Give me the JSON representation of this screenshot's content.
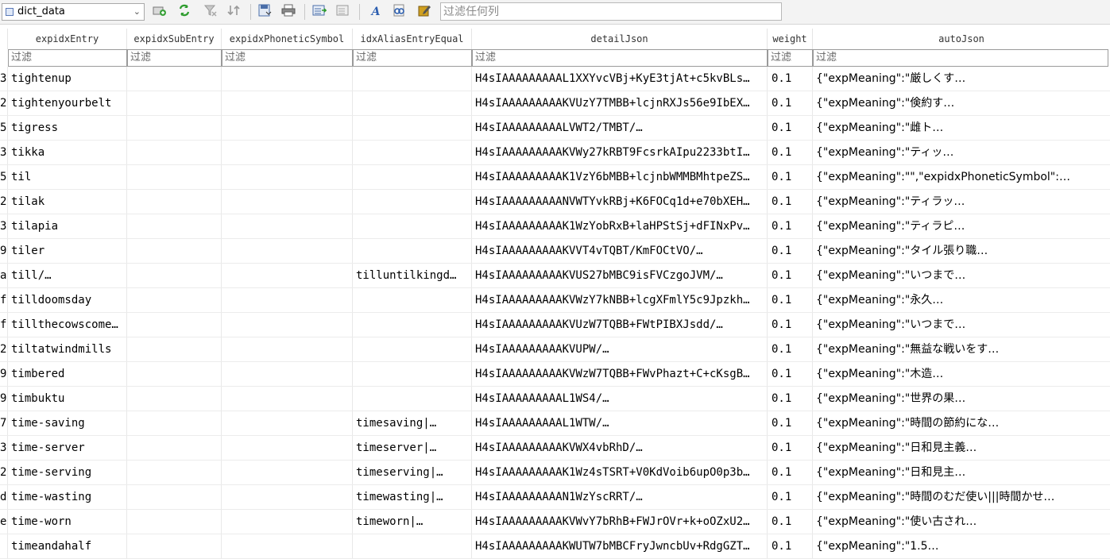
{
  "toolbar": {
    "table_name": "dict_data",
    "filter_placeholder": "过滤任何列",
    "icons": [
      "database-add-icon",
      "refresh-icon",
      "filter-clear-icon",
      "sort-clear-icon",
      "save-icon",
      "print-icon",
      "export-icon",
      "import-icon",
      "font-icon",
      "find-icon",
      "edit-icon"
    ]
  },
  "columns": [
    "expidxEntry",
    "expidxSubEntry",
    "expidxPhoneticSymbol",
    "idxAliasEntryEqual",
    "detailJson",
    "weight",
    "autoJson"
  ],
  "filter_placeholder": "过滤",
  "rows": [
    {
      "idx": "3",
      "entry": "tightenup",
      "sub": "",
      "phon": "",
      "alias": "",
      "detail": "H4sIAAAAAAAAAL1XXYvcVBj+KyE3tjAt+c5kvBLs…",
      "weight": "0.1",
      "auto": "{\"expMeaning\":\"厳しくす…"
    },
    {
      "idx": "2",
      "entry": "tightenyourbelt",
      "sub": "",
      "phon": "",
      "alias": "",
      "detail": "H4sIAAAAAAAAAKVUzY7TMBB+lcjnRXJs56e9IbEX…",
      "weight": "0.1",
      "auto": "{\"expMeaning\":\"倹約す…"
    },
    {
      "idx": "5",
      "entry": "tigress",
      "sub": "",
      "phon": "",
      "alias": "",
      "detail": "H4sIAAAAAAAAALVWT2/TMBT/…",
      "weight": "0.1",
      "auto": "{\"expMeaning\":\"雌ト…"
    },
    {
      "idx": "3",
      "entry": "tikka",
      "sub": "",
      "phon": "",
      "alias": "",
      "detail": "H4sIAAAAAAAAAKVWy27kRBT9FcsrkAIpu2233btI…",
      "weight": "0.1",
      "auto": "{\"expMeaning\":\"ティッ…"
    },
    {
      "idx": "5",
      "entry": "til",
      "sub": "",
      "phon": "",
      "alias": "",
      "detail": "H4sIAAAAAAAAAK1VzY6bMBB+lcjnbWMMBMhtpeZS…",
      "weight": "0.1",
      "auto": "{\"expMeaning\":\"\",\"expidxPhoneticSymbol\":…"
    },
    {
      "idx": "2",
      "entry": "tilak",
      "sub": "",
      "phon": "",
      "alias": "",
      "detail": "H4sIAAAAAAAAANVWTYvkRBj+K6FOCq1d+e70bXEH…",
      "weight": "0.1",
      "auto": "{\"expMeaning\":\"ティラッ…"
    },
    {
      "idx": "3",
      "entry": "tilapia",
      "sub": "",
      "phon": "",
      "alias": "",
      "detail": "H4sIAAAAAAAAAK1WzYobRxB+laHPStSj+dFINxPv…",
      "weight": "0.1",
      "auto": "{\"expMeaning\":\"ティラピ…"
    },
    {
      "idx": "9",
      "entry": "tiler",
      "sub": "",
      "phon": "",
      "alias": "",
      "detail": "H4sIAAAAAAAAAKVVT4vTQBT/KmFOCtVO/…",
      "weight": "0.1",
      "auto": "{\"expMeaning\":\"タイル張り職…"
    },
    {
      "idx": "a",
      "entry": "till/…",
      "sub": "",
      "phon": "",
      "alias": "tilluntilkingd…",
      "detail": "H4sIAAAAAAAAAKVUS27bMBC9isFVCzgoJVM/…",
      "weight": "0.1",
      "auto": "{\"expMeaning\":\"いつまで…"
    },
    {
      "idx": "f",
      "entry": "tilldoomsday",
      "sub": "",
      "phon": "",
      "alias": "",
      "detail": "H4sIAAAAAAAAAKVWzY7kNBB+lcgXFmlY5c9Jpzkh…",
      "weight": "0.1",
      "auto": "{\"expMeaning\":\"永久…"
    },
    {
      "idx": "f",
      "entry": "tillthecowscome…",
      "sub": "",
      "phon": "",
      "alias": "",
      "detail": "H4sIAAAAAAAAAKVUzW7TQBB+FWtPIBXJsdd/…",
      "weight": "0.1",
      "auto": "{\"expMeaning\":\"いつまで…"
    },
    {
      "idx": "2",
      "entry": "tiltatwindmills",
      "sub": "",
      "phon": "",
      "alias": "",
      "detail": "H4sIAAAAAAAAAKVUPW/…",
      "weight": "0.1",
      "auto": "{\"expMeaning\":\"無益な戦いをす…"
    },
    {
      "idx": "9",
      "entry": "timbered",
      "sub": "",
      "phon": "",
      "alias": "",
      "detail": "H4sIAAAAAAAAAKVWzW7TQBB+FWvPhazt+C+cKsgB…",
      "weight": "0.1",
      "auto": "{\"expMeaning\":\"木造…"
    },
    {
      "idx": "9",
      "entry": "timbuktu",
      "sub": "",
      "phon": "",
      "alias": "",
      "detail": "H4sIAAAAAAAAAL1WS4/…",
      "weight": "0.1",
      "auto": "{\"expMeaning\":\"世界の果…"
    },
    {
      "idx": "7",
      "entry": "time-saving",
      "sub": "",
      "phon": "",
      "alias": "timesaving|…",
      "detail": "H4sIAAAAAAAAAL1WTW/…",
      "weight": "0.1",
      "auto": "{\"expMeaning\":\"時間の節約にな…"
    },
    {
      "idx": "3",
      "entry": "time-server",
      "sub": "",
      "phon": "",
      "alias": "timeserver|…",
      "detail": "H4sIAAAAAAAAAKVWX4vbRhD/…",
      "weight": "0.1",
      "auto": "{\"expMeaning\":\"日和見主義…"
    },
    {
      "idx": "2",
      "entry": "time-serving",
      "sub": "",
      "phon": "",
      "alias": "timeserving|…",
      "detail": "H4sIAAAAAAAAAK1Wz4sTSRT+V0KdVoib6upO0p3b…",
      "weight": "0.1",
      "auto": "{\"expMeaning\":\"日和見主…"
    },
    {
      "idx": "d",
      "entry": "time-wasting",
      "sub": "",
      "phon": "",
      "alias": "timewasting|…",
      "detail": "H4sIAAAAAAAAAN1WzYscRRT/…",
      "weight": "0.1",
      "auto": "{\"expMeaning\":\"時間のむだ使い|||時間かせ…"
    },
    {
      "idx": "e",
      "entry": "time-worn",
      "sub": "",
      "phon": "",
      "alias": "timeworn|…",
      "detail": "H4sIAAAAAAAAAKVWvY7bRhB+FWJrOVr+k+oOZxU2…",
      "weight": "0.1",
      "auto": "{\"expMeaning\":\"使い古され…"
    },
    {
      "idx": "",
      "entry": "timeandahalf",
      "sub": "",
      "phon": "",
      "alias": "",
      "detail": "H4sIAAAAAAAAAKWUTW7bMBCFryJwncbUv+RdgGZT…",
      "weight": "0.1",
      "auto": "{\"expMeaning\":\"1.5…"
    }
  ]
}
